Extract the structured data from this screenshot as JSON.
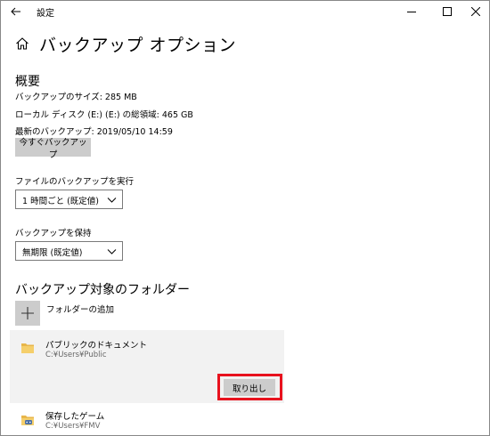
{
  "window": {
    "title": "設定",
    "icons": {
      "back": "back-arrow-icon",
      "minimize": "minimize-icon",
      "maximize": "maximize-icon",
      "close": "close-icon",
      "home": "home-icon"
    }
  },
  "page": {
    "title": "バックアップ オプション"
  },
  "overview": {
    "heading": "概要",
    "backup_size": "バックアップのサイズ: 285 MB",
    "disk_space": "ローカル ディスク (E:) (E:) の総領域: 465 GB",
    "last_backup": "最新のバックアップ: 2019/05/10 14:59",
    "backup_now_button": "今すぐバックアップ"
  },
  "schedule": {
    "label": "ファイルのバックアップを実行",
    "selected": "1 時間ごと (既定値)"
  },
  "retention": {
    "label": "バックアップを保持",
    "selected": "無期限 (既定値)"
  },
  "folders": {
    "heading": "バックアップ対象のフォルダー",
    "add_label": "フォルダーの追加",
    "items": [
      {
        "name": "パブリックのドキュメント",
        "path": "C:¥Users¥Public",
        "icon": "folder-icon",
        "selected": true,
        "remove_label": "取り出し"
      },
      {
        "name": "保存したゲーム",
        "path": "C:¥Users¥FMV",
        "icon": "saved-games-icon",
        "selected": false
      }
    ]
  },
  "colors": {
    "button_bg": "#cccccc",
    "selected_panel": "#f2f2f2",
    "highlight": "#e8121e",
    "folder": "#e8b64a"
  }
}
